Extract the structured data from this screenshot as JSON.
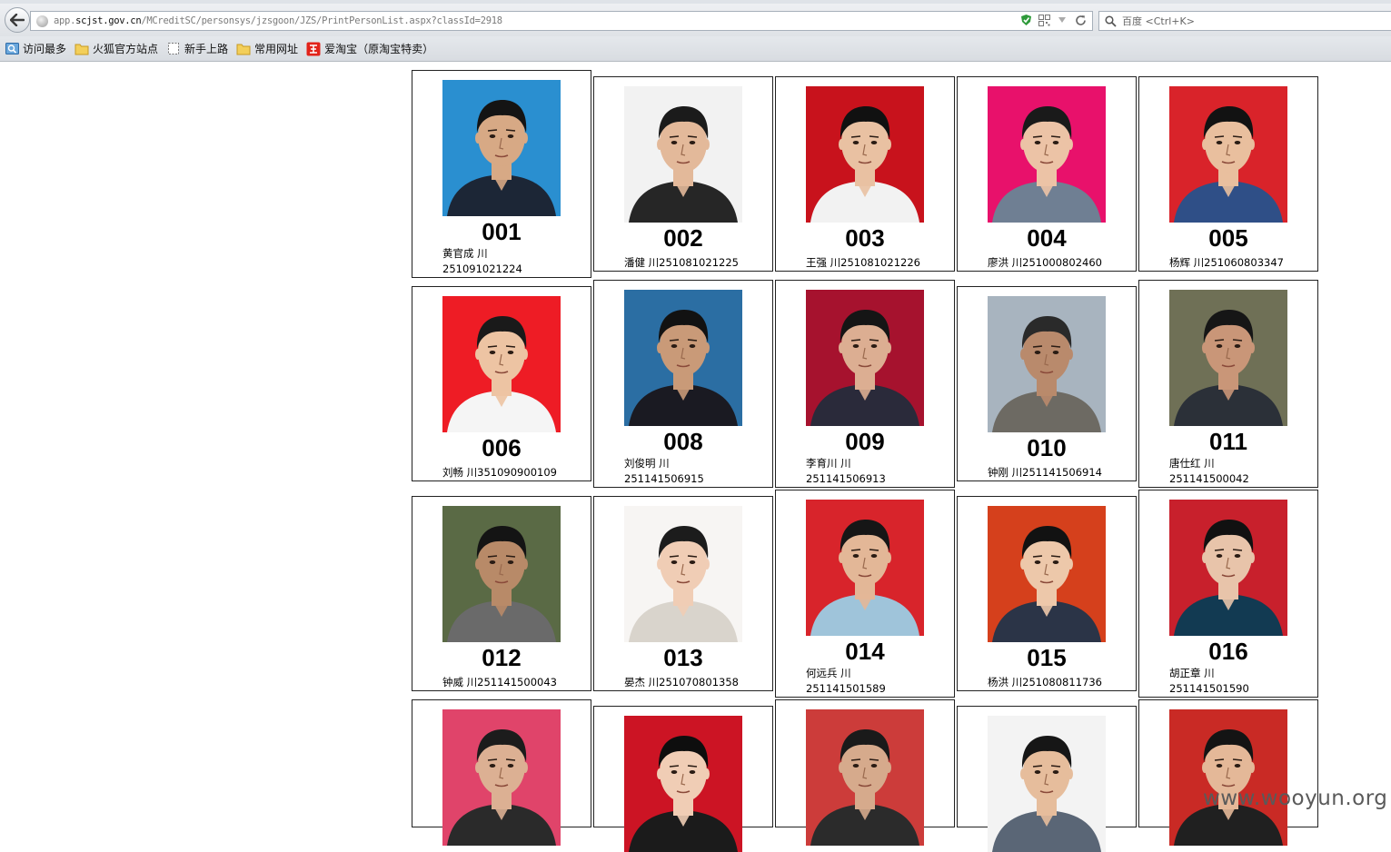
{
  "browser": {
    "url_prefix": "app.",
    "url_domain": "scjst.gov.cn",
    "url_path": "/MCreditSC/personsys/jzsgoon/JZS/PrintPersonList.aspx?classId=2918",
    "search_placeholder": "百度 <Ctrl+K>"
  },
  "bookmarks": [
    {
      "label": "访问最多",
      "icon": "most-visited-icon"
    },
    {
      "label": "火狐官方站点",
      "icon": "folder-icon"
    },
    {
      "label": "新手上路",
      "icon": "page-icon"
    },
    {
      "label": "常用网址",
      "icon": "folder-icon"
    },
    {
      "label": "爱淘宝（原淘宝特卖）",
      "icon": "taobao-icon"
    }
  ],
  "persons": [
    {
      "number": "001",
      "line1": "黄官成 川",
      "line2": "251091021224",
      "bg": "#2a8fd0",
      "shirt": "#1c2636",
      "skin": "#d7a985",
      "hair": "#141414"
    },
    {
      "number": "002",
      "line1": "潘健 川251081021225",
      "line2": "",
      "bg": "#f2f2f2",
      "shirt": "#262626",
      "skin": "#e3b99a",
      "hair": "#1b1b1b"
    },
    {
      "number": "003",
      "line1": "王强 川251081021226",
      "line2": "",
      "bg": "#c8121c",
      "shirt": "#f2f2f2",
      "skin": "#e9c1a2",
      "hair": "#111111"
    },
    {
      "number": "004",
      "line1": "廖洪 川251000802460",
      "line2": "",
      "bg": "#e8116b",
      "shirt": "#6f7f93",
      "skin": "#ecc3a6",
      "hair": "#1a1a1a"
    },
    {
      "number": "005",
      "line1": "杨辉 川251060803347",
      "line2": "",
      "bg": "#d9232a",
      "shirt": "#2f4f87",
      "skin": "#e9bf9e",
      "hair": "#121212"
    },
    {
      "number": "006",
      "line1": "刘畅 川351090900109",
      "line2": "",
      "bg": "#ee1c25",
      "shirt": "#f5f5f5",
      "skin": "#edc4a3",
      "hair": "#1a1a1a"
    },
    {
      "number": "008",
      "line1": "刘俊明 川",
      "line2": "251141506915",
      "bg": "#2b6ea3",
      "shirt": "#1a1a22",
      "skin": "#c99a78",
      "hair": "#121212"
    },
    {
      "number": "009",
      "line1": "李育川 川",
      "line2": "251141506913",
      "bg": "#a6122e",
      "shirt": "#2a2a3a",
      "skin": "#dcae92",
      "hair": "#151515"
    },
    {
      "number": "010",
      "line1": "钟刚 川251141506914",
      "line2": "",
      "bg": "#a8b4bf",
      "shirt": "#6d6a63",
      "skin": "#b98a6c",
      "hair": "#2a2a2a"
    },
    {
      "number": "011",
      "line1": "唐仕红 川",
      "line2": "251141500042",
      "bg": "#6f7056",
      "shirt": "#2b3038",
      "skin": "#c99678",
      "hair": "#161616"
    },
    {
      "number": "012",
      "line1": "钟威 川251141500043",
      "line2": "",
      "bg": "#5a6a45",
      "shirt": "#6a6a6a",
      "skin": "#b88a68",
      "hair": "#141414"
    },
    {
      "number": "013",
      "line1": "晏杰 川251070801358",
      "line2": "",
      "bg": "#f7f5f3",
      "shirt": "#d9d4cc",
      "skin": "#f0cdb5",
      "hair": "#1c1c1c"
    },
    {
      "number": "014",
      "line1": "何远兵 川",
      "line2": "251141501589",
      "bg": "#d8242b",
      "shirt": "#9fc4da",
      "skin": "#e3b797",
      "hair": "#161616"
    },
    {
      "number": "015",
      "line1": "杨洪 川251080811736",
      "line2": "",
      "bg": "#d5401c",
      "shirt": "#2b3447",
      "skin": "#edc8aa",
      "hair": "#121212"
    },
    {
      "number": "016",
      "line1": "胡正章 川",
      "line2": "251141501590",
      "bg": "#c8202c",
      "shirt": "#123a52",
      "skin": "#e8c4aa",
      "hair": "#111111"
    },
    {
      "number": "",
      "line1": "",
      "line2": "",
      "bg": "#e0446a",
      "shirt": "#2a2a2a",
      "skin": "#dcb093",
      "hair": "#1c1c1c"
    },
    {
      "number": "",
      "line1": "",
      "line2": "",
      "bg": "#cc1424",
      "shirt": "#1b1b1b",
      "skin": "#f0cdb5",
      "hair": "#0e0e0e"
    },
    {
      "number": "",
      "line1": "",
      "line2": "",
      "bg": "#cc3c3a",
      "shirt": "#2b2b2b",
      "skin": "#d6aa8c",
      "hair": "#1a1a1a"
    },
    {
      "number": "",
      "line1": "",
      "line2": "",
      "bg": "#f3f3f3",
      "shirt": "#5a6676",
      "skin": "#e6bd9c",
      "hair": "#161616"
    },
    {
      "number": "",
      "line1": "",
      "line2": "",
      "bg": "#c92a25",
      "shirt": "#202020",
      "skin": "#e4b898",
      "hair": "#141414"
    }
  ],
  "watermark": "www.wooyun.org"
}
